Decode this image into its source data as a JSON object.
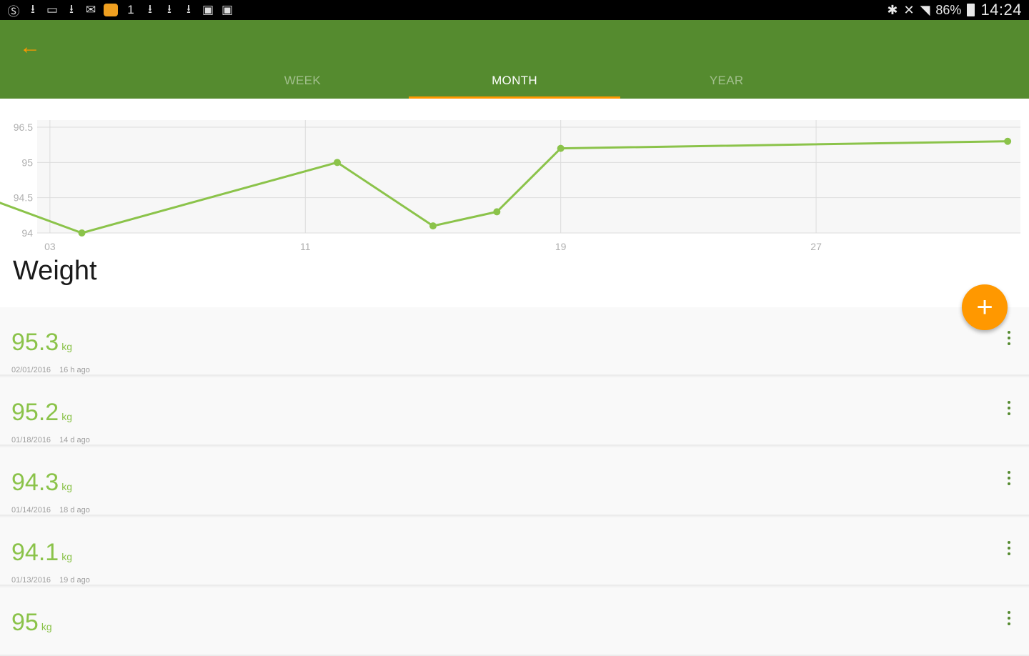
{
  "status_bar": {
    "battery": "86%",
    "time": "14:24",
    "left_icons": [
      "skype-icon",
      "download-icon",
      "image-icon",
      "download-icon",
      "message-icon",
      "app-icon",
      "signal-icon",
      "download-icon",
      "download-icon",
      "download-icon",
      "photo-icon",
      "photo-icon"
    ],
    "right_icons": [
      "bluetooth-icon",
      "mute-icon",
      "wifi-icon",
      "battery-icon"
    ]
  },
  "app_bar": {
    "back_icon": "arrow-left-icon",
    "tabs": [
      {
        "label": "WEEK",
        "active": false
      },
      {
        "label": "MONTH",
        "active": true
      },
      {
        "label": "YEAR",
        "active": false
      }
    ],
    "accent": "#ff9800",
    "bar_color": "#558b2f"
  },
  "chart_data": {
    "type": "line",
    "x": [
      1,
      4,
      12,
      15,
      17,
      19,
      33
    ],
    "values": [
      94.5,
      94.0,
      95.0,
      94.1,
      94.3,
      95.2,
      95.3
    ],
    "x_ticks": [
      "03",
      "11",
      "19",
      "27"
    ],
    "x_tick_values": [
      3,
      11,
      19,
      27
    ],
    "y_ticks": [
      "96.5",
      "95",
      "94.5",
      "94"
    ],
    "y_tick_values": [
      95.5,
      95,
      94.5,
      94
    ],
    "ylim": [
      94,
      95.5
    ],
    "xlim": [
      2.6,
      33.4
    ],
    "grid": true,
    "line_color": "#8bc34a"
  },
  "section_title": "Weight",
  "fab": {
    "icon": "plus-icon",
    "label": "+"
  },
  "entries": [
    {
      "value": "95.3",
      "unit": "kg",
      "date": "02/01/2016",
      "ago": "16 h ago"
    },
    {
      "value": "95.2",
      "unit": "kg",
      "date": "01/18/2016",
      "ago": "14 d ago"
    },
    {
      "value": "94.3",
      "unit": "kg",
      "date": "01/14/2016",
      "ago": "18 d ago"
    },
    {
      "value": "94.1",
      "unit": "kg",
      "date": "01/13/2016",
      "ago": "19 d ago"
    },
    {
      "value": "95",
      "unit": "kg",
      "date": "",
      "ago": ""
    }
  ]
}
